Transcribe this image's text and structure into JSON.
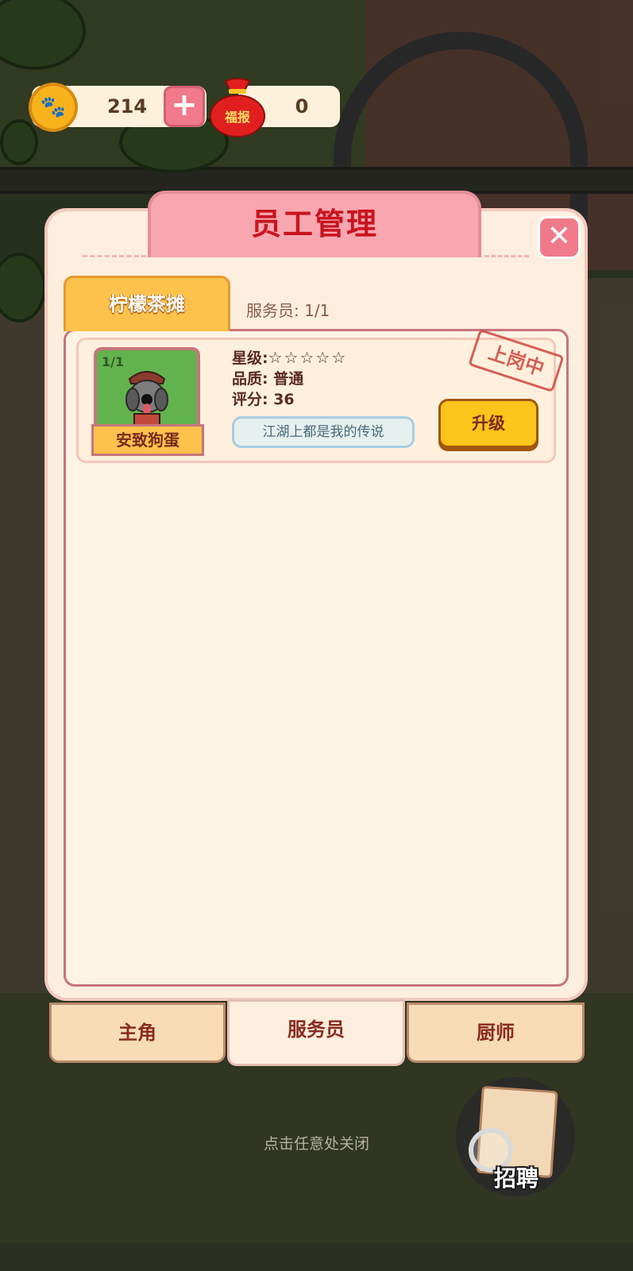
{
  "currency": {
    "coins": "214",
    "lucky_bag_icon_text": "福报",
    "lucky_bag_count": "0"
  },
  "panel": {
    "title": "员工管理",
    "store_tab_label": "柠檬茶摊",
    "staff_count": "服务员: 1/1"
  },
  "employee": {
    "slot_count": "1/1",
    "name": "安致狗蛋",
    "star_label": "星级:",
    "stars": "☆☆☆☆☆",
    "quality": "品质: 普通",
    "score": "评分: 36",
    "motto": "江湖上都是我的传说",
    "upgrade_label": "升级",
    "status_stamp": "上岗中"
  },
  "bottom_tabs": [
    {
      "label": "主角",
      "active": false
    },
    {
      "label": "服务员",
      "active": true
    },
    {
      "label": "厨师",
      "active": false
    }
  ],
  "close_hint": "点击任意处关闭",
  "recruit_label": "招聘",
  "colors": {
    "title_red": "#c8141e",
    "tab_pink": "#f8a7b0",
    "button_yellow": "#fdc41b",
    "panel_cream": "#fdeede"
  }
}
